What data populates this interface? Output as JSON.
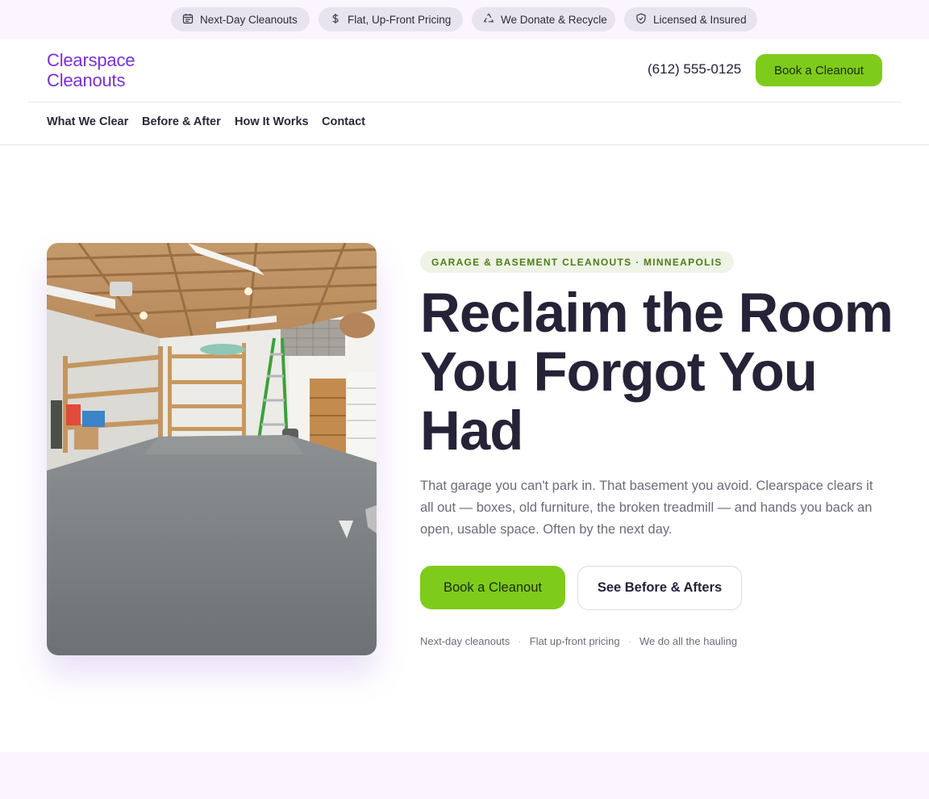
{
  "topbar": {
    "items": [
      {
        "label": "Next-Day Cleanouts",
        "icon": "calendar-icon"
      },
      {
        "label": "Flat, Up-Front Pricing",
        "icon": "dollar-icon"
      },
      {
        "label": "We Donate & Recycle",
        "icon": "recycle-icon"
      },
      {
        "label": "Licensed & Insured",
        "icon": "shield-icon"
      }
    ]
  },
  "header": {
    "logo_line1": "Clearspace",
    "logo_line2": "Cleanouts",
    "phone": "(612) 555-0125",
    "cta_label": "Book a Cleanout"
  },
  "nav": {
    "items": [
      "What We Clear",
      "Before & After",
      "How It Works",
      "Contact"
    ]
  },
  "hero": {
    "eyebrow": "GARAGE & BASEMENT CLEANOUTS · MINNEAPOLIS",
    "headline": "Reclaim the Room You Forgot You Had",
    "subtext": "That garage you can't park in. That basement you avoid. Clearspace clears it all out — boxes, old furniture, the broken treadmill — and hands you back an open, usable space. Often by the next day.",
    "primary_cta": "Book a Cleanout",
    "secondary_cta": "See Before & Afters",
    "trust": [
      "Next-day cleanouts",
      "Flat up-front pricing",
      "We do all the hauling"
    ]
  },
  "colors": {
    "brand_purple": "#7a2fd6",
    "accent_green": "#7ecb1c",
    "eyebrow_green": "#4d7c16",
    "text_dark": "#262338",
    "topbar_bg": "#faf5fe"
  }
}
